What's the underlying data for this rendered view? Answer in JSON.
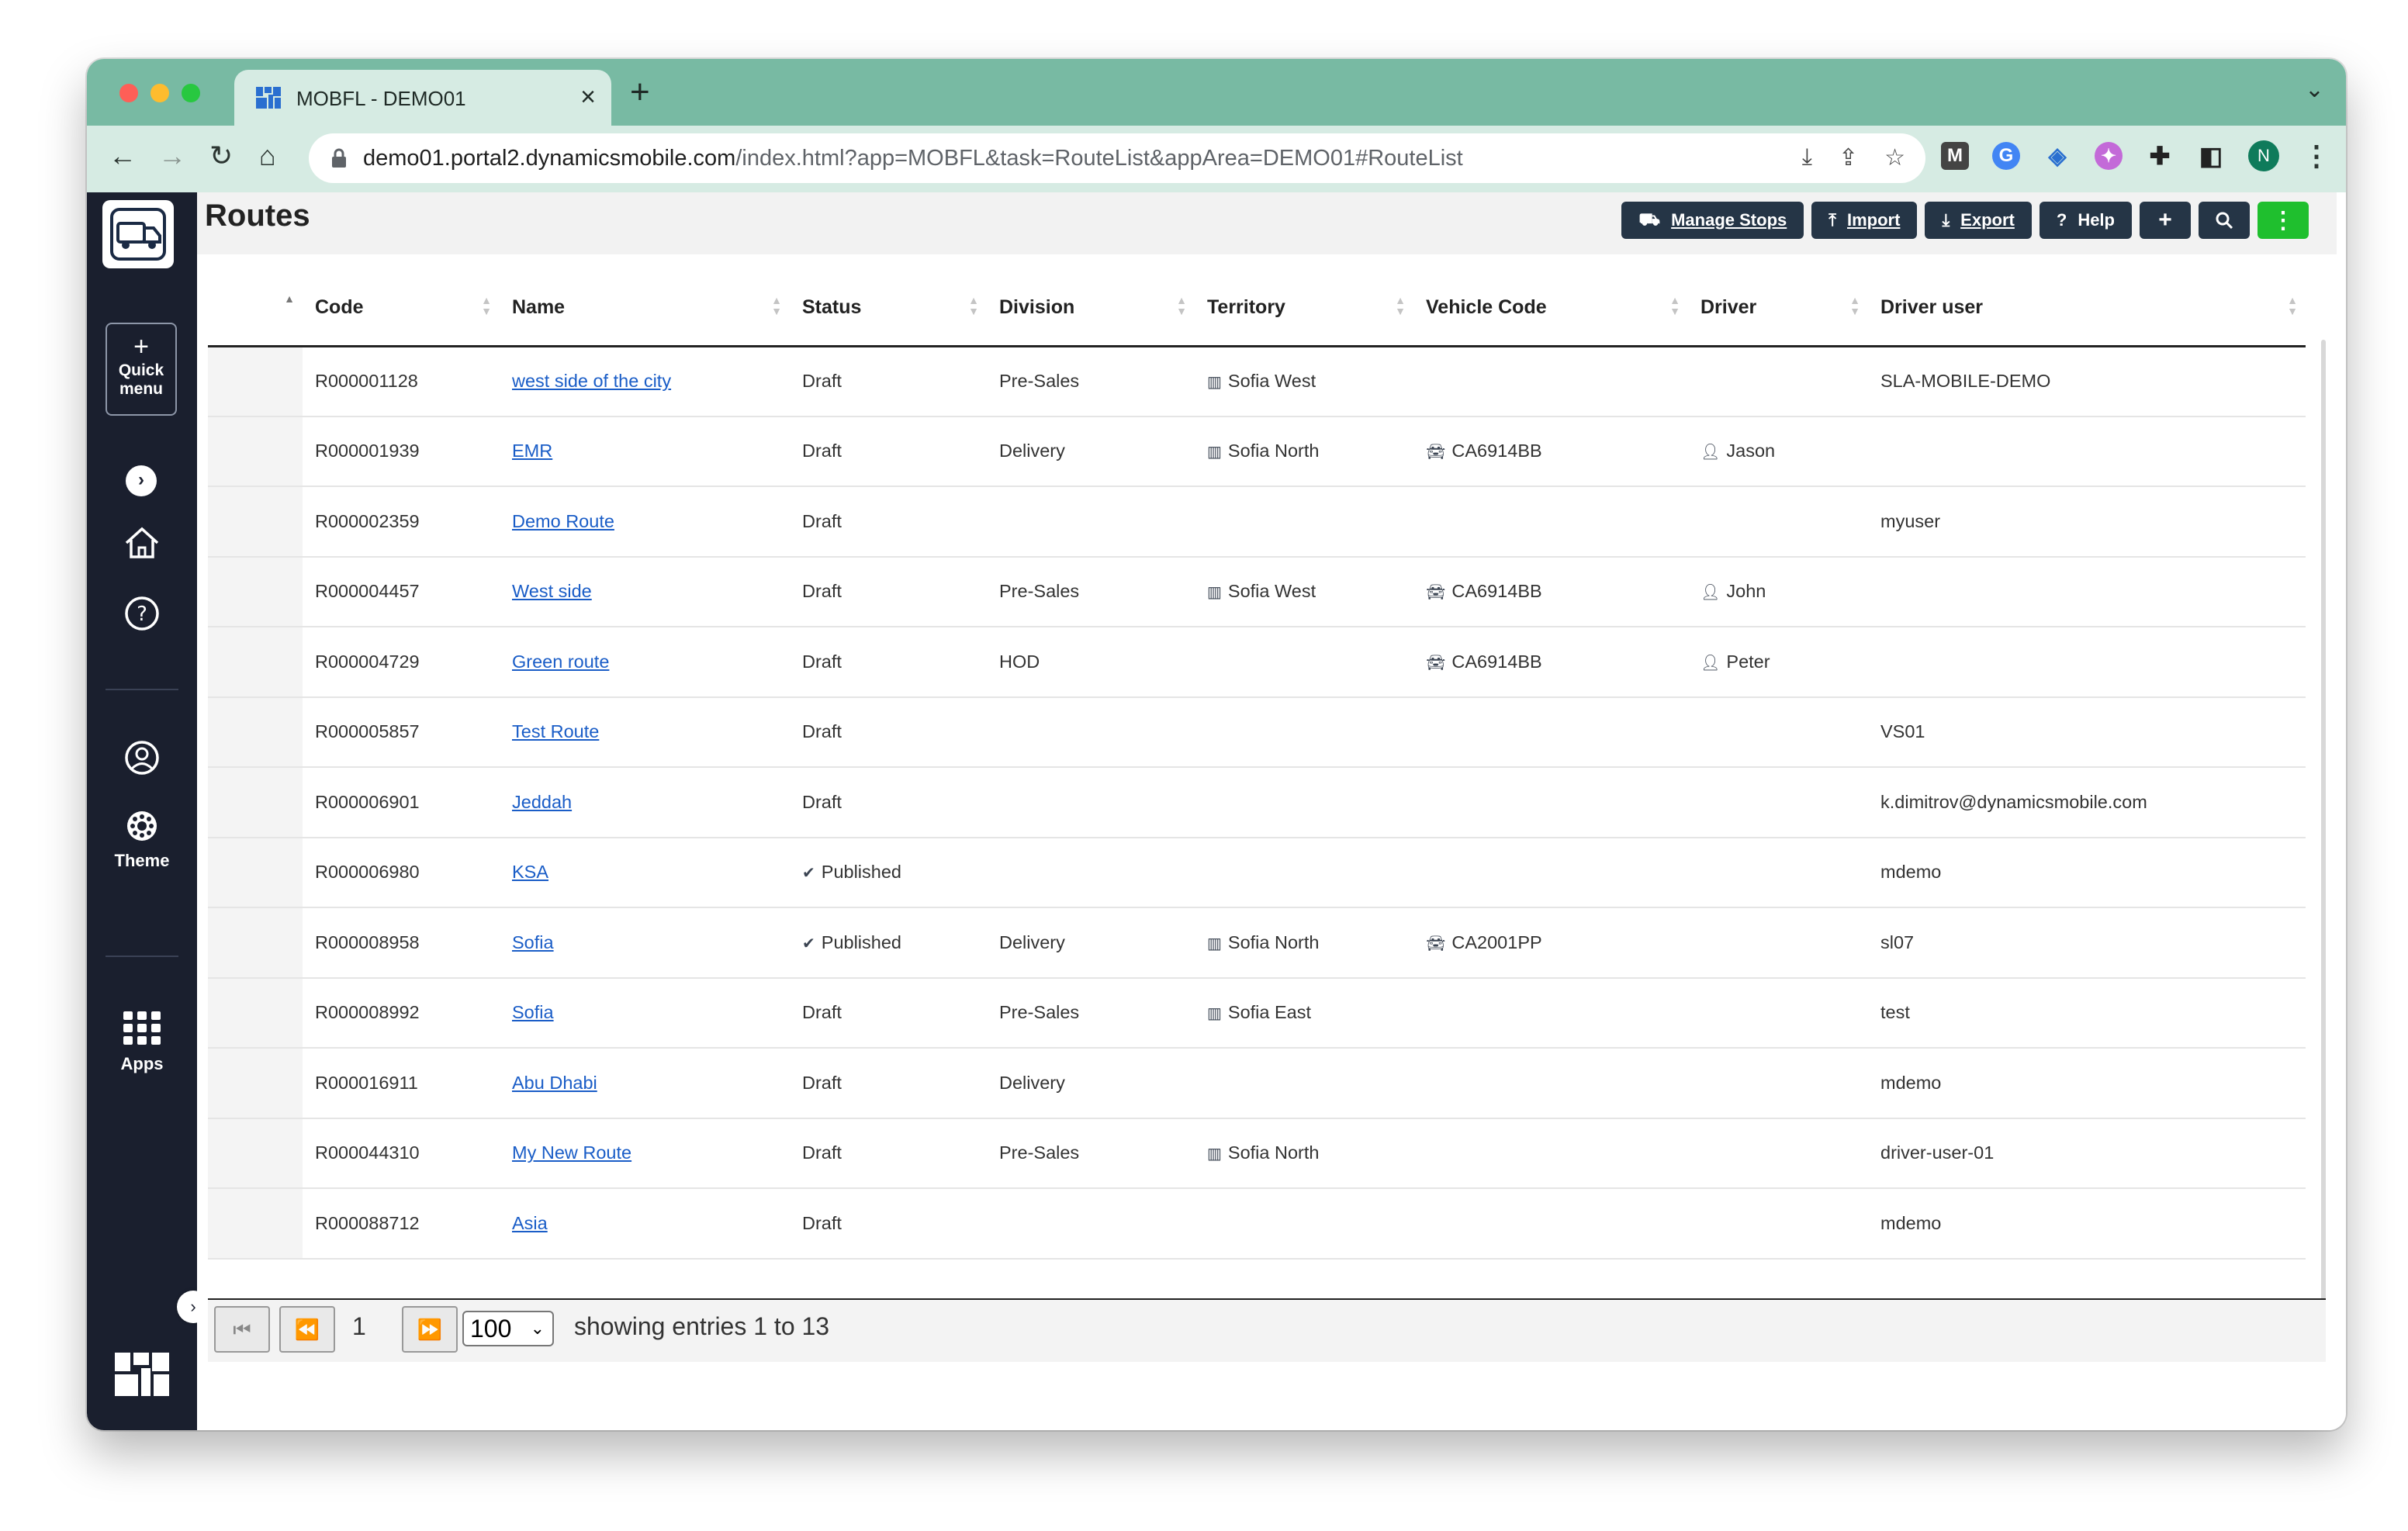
{
  "browser": {
    "tab_title": "MOBFL - DEMO01",
    "tab_close": "×",
    "new_tab": "+",
    "url_host": "demo01.portal2.dynamicsmobile.com",
    "url_path": "/index.html?app=MOBFL&task=RouteList&appArea=DEMO01#RouteList",
    "profile_initial": "N"
  },
  "sidebar": {
    "quick_menu_plus": "+",
    "quick_menu_label_1": "Quick",
    "quick_menu_label_2": "menu",
    "theme_label": "Theme",
    "apps_label": "Apps"
  },
  "page": {
    "title": "Routes"
  },
  "actions": {
    "manage_stops": "Manage Stops",
    "import": "Import",
    "export": "Export",
    "help": "Help"
  },
  "table": {
    "columns": [
      "Code",
      "Name",
      "Status",
      "Division",
      "Territory",
      "Vehicle Code",
      "Driver",
      "Driver user"
    ],
    "rows": [
      {
        "code": "R000001128",
        "name": "west side of the city",
        "status": "Draft",
        "published": false,
        "division": "Pre-Sales",
        "territory": "Sofia West",
        "vehicle": "",
        "driver": "",
        "driver_user": "SLA-MOBILE-DEMO"
      },
      {
        "code": "R000001939",
        "name": "EMR",
        "status": "Draft",
        "published": false,
        "division": "Delivery",
        "territory": "Sofia North",
        "vehicle": "CA6914BB",
        "driver": "Jason",
        "driver_user": ""
      },
      {
        "code": "R000002359",
        "name": "Demo Route",
        "status": "Draft",
        "published": false,
        "division": "",
        "territory": "",
        "vehicle": "",
        "driver": "",
        "driver_user": "myuser"
      },
      {
        "code": "R000004457",
        "name": "West side",
        "status": "Draft",
        "published": false,
        "division": "Pre-Sales",
        "territory": "Sofia West",
        "vehicle": "CA6914BB",
        "driver": "John",
        "driver_user": ""
      },
      {
        "code": "R000004729",
        "name": "Green route",
        "status": "Draft",
        "published": false,
        "division": "HOD",
        "territory": "",
        "vehicle": "CA6914BB",
        "driver": "Peter",
        "driver_user": ""
      },
      {
        "code": "R000005857",
        "name": "Test Route",
        "status": "Draft",
        "published": false,
        "division": "",
        "territory": "",
        "vehicle": "",
        "driver": "",
        "driver_user": "VS01"
      },
      {
        "code": "R000006901",
        "name": "Jeddah",
        "status": "Draft",
        "published": false,
        "division": "",
        "territory": "",
        "vehicle": "",
        "driver": "",
        "driver_user": "k.dimitrov@dynamicsmobile.com"
      },
      {
        "code": "R000006980",
        "name": "KSA",
        "status": "Published",
        "published": true,
        "division": "",
        "territory": "",
        "vehicle": "",
        "driver": "",
        "driver_user": "mdemo"
      },
      {
        "code": "R000008958",
        "name": "Sofia",
        "status": "Published",
        "published": true,
        "division": "Delivery",
        "territory": "Sofia North",
        "vehicle": "CA2001PP",
        "driver": "",
        "driver_user": "sl07"
      },
      {
        "code": "R000008992",
        "name": "Sofia",
        "status": "Draft",
        "published": false,
        "division": "Pre-Sales",
        "territory": "Sofia East",
        "vehicle": "",
        "driver": "",
        "driver_user": "test"
      },
      {
        "code": "R000016911",
        "name": "Abu Dhabi",
        "status": "Draft",
        "published": false,
        "division": "Delivery",
        "territory": "",
        "vehicle": "",
        "driver": "",
        "driver_user": "mdemo"
      },
      {
        "code": "R000044310",
        "name": "My New Route",
        "status": "Draft",
        "published": false,
        "division": "Pre-Sales",
        "territory": "Sofia North",
        "vehicle": "",
        "driver": "",
        "driver_user": "driver-user-01"
      },
      {
        "code": "R000088712",
        "name": "Asia",
        "status": "Draft",
        "published": false,
        "division": "",
        "territory": "",
        "vehicle": "",
        "driver": "",
        "driver_user": "mdemo"
      }
    ]
  },
  "pager": {
    "page": "1",
    "page_size": "100",
    "info": "showing entries 1 to 13"
  },
  "colors": {
    "chrome_tab_bar": "#78baa3",
    "sidebar": "#1a1f2e",
    "action_button": "#253546",
    "green_button": "#1fbf2e",
    "link": "#1a5dc7"
  }
}
